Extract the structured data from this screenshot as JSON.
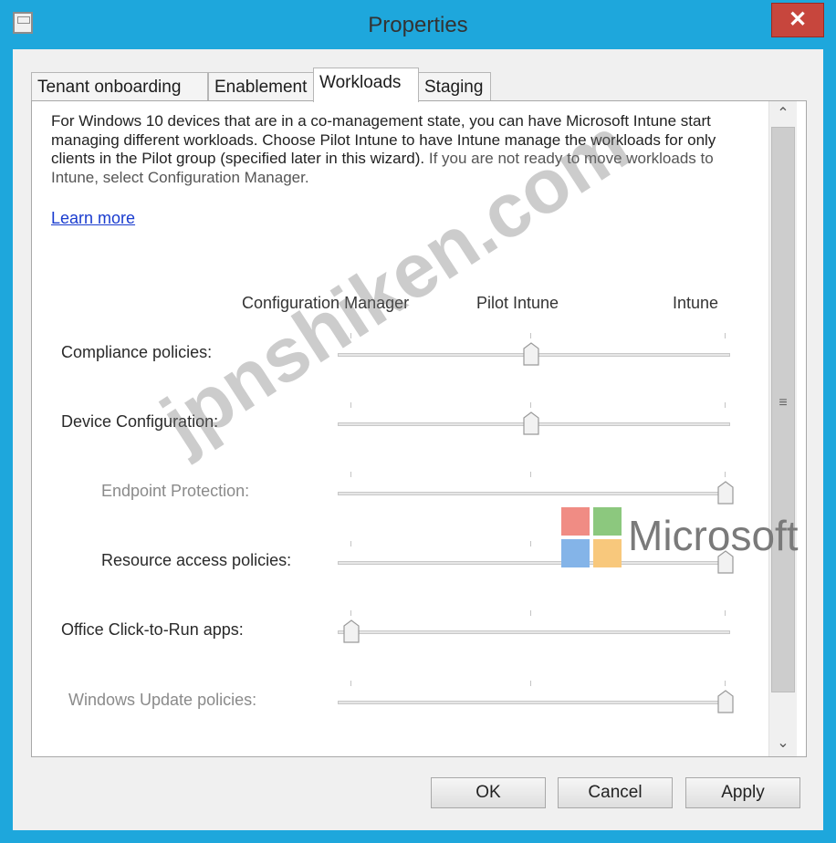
{
  "window": {
    "title": "Properties",
    "close_glyph": "✕"
  },
  "tabs": [
    {
      "label": "Tenant onboarding"
    },
    {
      "label": "Enablement"
    },
    {
      "label": "Workloads",
      "active": true
    },
    {
      "label": "Staging"
    }
  ],
  "content": {
    "description_part1": "For Windows 10 devices that are in a co-management state, you can have Microsoft Intune start managing different workloads. Choose Pilot Intune to have Intune manage the workloads for only clients in the Pilot group (specified later in this wizard).",
    "description_part2": " If you are not ready to move workloads to Intune, select Configuration Manager.",
    "learn_more": "Learn more"
  },
  "columns": [
    "Configuration Manager",
    "Pilot Intune",
    "Intune"
  ],
  "workloads": [
    {
      "label": "Compliance policies:",
      "value": "Pilot Intune",
      "position": 1,
      "enabled": true,
      "indented": false
    },
    {
      "label": "Device Configuration:",
      "value": "Pilot Intune",
      "position": 1,
      "enabled": true,
      "indented": false
    },
    {
      "label": "Endpoint Protection:",
      "value": "Intune",
      "position": 2,
      "enabled": false,
      "indented": true
    },
    {
      "label": "Resource access policies:",
      "value": "Intune",
      "position": 2,
      "enabled": true,
      "indented": true
    },
    {
      "label": "Office Click-to-Run apps:",
      "value": "Configuration Manager",
      "position": 0,
      "enabled": true,
      "indented": false
    },
    {
      "label": "Windows Update policies:",
      "value": "Intune",
      "position": 2,
      "enabled": false,
      "indented": false
    }
  ],
  "buttons": {
    "ok": "OK",
    "cancel": "Cancel",
    "apply": "Apply"
  },
  "overlays": {
    "watermark": "jpnshiken.com",
    "brand": "Microsoft"
  },
  "colors": {
    "titlebar": "#1ea7dc",
    "close": "#c7463d",
    "link": "#1a3ccf",
    "ms_red": "#f08c84",
    "ms_green": "#8cc87e",
    "ms_blue": "#84b4e8",
    "ms_yellow": "#f8c87c"
  }
}
